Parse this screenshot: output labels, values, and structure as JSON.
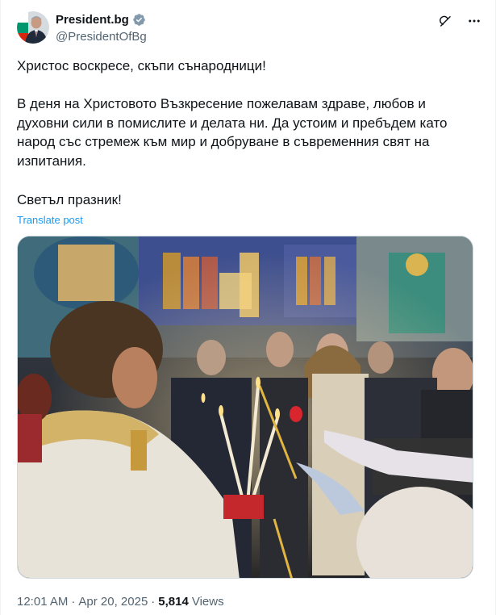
{
  "author": {
    "display_name": "President.bg",
    "handle": "@PresidentOfBg",
    "verified_icon": "verified-badge-icon",
    "badge_color": "#829aab"
  },
  "header_actions": {
    "grok_icon": "grok-icon",
    "more_icon": "more-icon"
  },
  "tweet": {
    "line1": "Христос воскресе, скъпи сънародници!",
    "paragraph": "В деня на Христовото Възкресение пожелавам здраве, любов и духовни сили в помислите и делата ни. Да устоим и пребъдем като народ със стремеж към мир и добруване в съвременния свят на изпитания.",
    "closing": "Светъл празник!",
    "translate_label": "Translate post"
  },
  "meta": {
    "time": "12:01 AM",
    "separator": "·",
    "date": "Apr 20, 2025",
    "views_count": "5,814",
    "views_label": "Views"
  },
  "colors": {
    "accent": "#1d9bf0",
    "text": "#0f1419",
    "muted": "#536471"
  }
}
